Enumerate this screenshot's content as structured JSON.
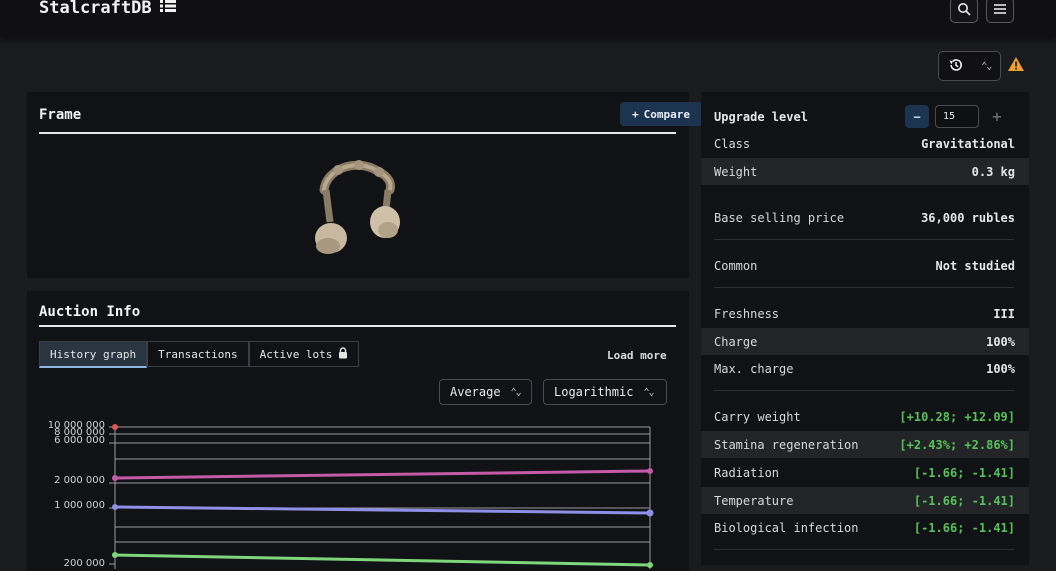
{
  "header": {
    "brand": "StalcraftDB"
  },
  "frame": {
    "title": "Frame",
    "compare_label": "Compare"
  },
  "auction": {
    "title": "Auction Info",
    "tabs": [
      {
        "label": "History graph"
      },
      {
        "label": "Transactions"
      },
      {
        "label": "Active lots"
      }
    ],
    "load_more": "Load more",
    "price_type": "Average",
    "scale": "Logarithmic",
    "y_ticks": [
      "10 000 000",
      "8 000 000",
      "6 000 000",
      "2 000 000",
      "1 000 000",
      "200 000"
    ]
  },
  "stats": {
    "upgrade_label": "Upgrade level",
    "upgrade_value": "15",
    "rows": [
      {
        "label": "Class",
        "value": "Gravitational"
      },
      {
        "label": "Weight",
        "value": "0.3 kg"
      },
      {
        "label": "Base selling price",
        "value": "36,000 rubles"
      },
      {
        "label": "Common",
        "value": "Not studied"
      },
      {
        "label": "Freshness",
        "value": "III"
      },
      {
        "label": "Charge",
        "value": "100%"
      },
      {
        "label": "Max. charge",
        "value": "100%"
      },
      {
        "label": "Carry weight",
        "value": "[+10.28; +12.09]"
      },
      {
        "label": "Stamina regeneration",
        "value": "[+2.43%; +2.86%]"
      },
      {
        "label": "Radiation",
        "value": "[-1.66; -1.41]"
      },
      {
        "label": "Temperature",
        "value": "[-1.66; -1.41]"
      },
      {
        "label": "Biological infection",
        "value": "[-1.66; -1.41]"
      }
    ]
  },
  "colors": {
    "accent": "#1c3450",
    "positive": "#56c25a",
    "warning": "#f0a030",
    "series_red": "#e05555",
    "series_pink": "#c45aa8",
    "series_purple": "#8f8fe8",
    "series_green": "#7fd67a"
  },
  "icons": [
    "list-icon",
    "search-icon",
    "menu-icon",
    "history-icon",
    "updown-chevron-icon",
    "warning-icon",
    "plus-icon",
    "lock-icon",
    "minus-icon"
  ]
}
